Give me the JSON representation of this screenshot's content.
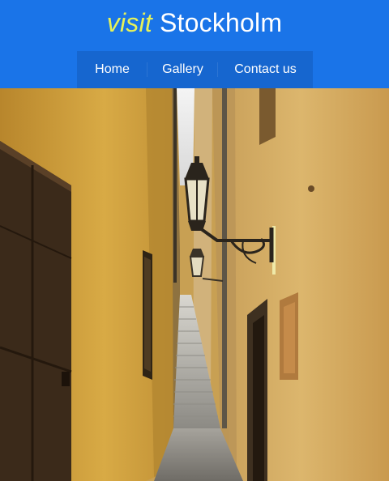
{
  "header": {
    "brand_prefix": "visit",
    "brand_name": "Stockholm"
  },
  "nav": {
    "items": [
      {
        "label": "Home"
      },
      {
        "label": "Gallery"
      },
      {
        "label": "Contact us"
      }
    ]
  },
  "colors": {
    "header_bg": "#1a74e8",
    "nav_bg": "#1666cf",
    "brand_accent": "#e6f25a"
  }
}
